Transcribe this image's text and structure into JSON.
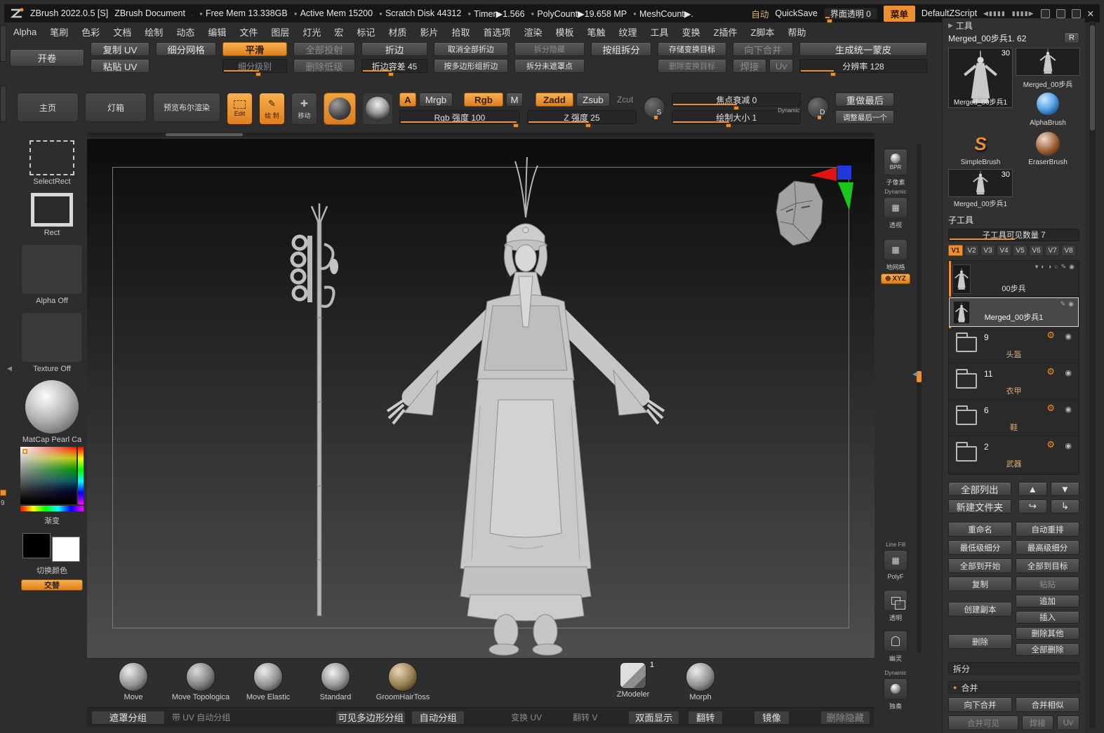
{
  "colors": {
    "accent": "#ec8f2e",
    "panel": "#313131"
  },
  "icons": {
    "close": "✕",
    "bullet": "●",
    "dot": ".",
    "tri_right": "▶",
    "collapse_left": "◀",
    "up": "▲",
    "down": "▼",
    "arrow_out": "↪",
    "arrow_in": "↳",
    "gear": "⚙",
    "eye": "◉",
    "pencil": "✎",
    "half_left": "◐",
    "half_right": "◑",
    "circle": "○",
    "caret_down": "▾",
    "plus": "✚",
    "grid": "▦",
    "win_left": "◀▮▮▮▮",
    "win_right": "▮▮▮▮▶",
    "s": "S",
    "d": "D",
    "divider_dots": "··········",
    "divider_arrows": "▲▼",
    "xyz_prefix": "⊕"
  },
  "titlebar": {
    "app_title": "ZBrush 2022.0.5 [S]",
    "doc_title": "ZBrush Document",
    "stats": [
      "Free Mem 13.338GB",
      "Active Mem 15200",
      "Scratch Disk 44312",
      "Timer▶1.566",
      "PolyCount▶19.658 MP",
      "MeshCount▶."
    ],
    "auto": "自动",
    "quicksave": "QuickSave",
    "ui_opacity": "界面透明 0",
    "menu_btn": "菜单",
    "zscript": "DefaultZScript"
  },
  "menubar": {
    "items": [
      "Alpha",
      "笔刷",
      "色彩",
      "文档",
      "绘制",
      "动态",
      "编辑",
      "文件",
      "图层",
      "灯光",
      "宏",
      "标记",
      "材质",
      "影片",
      "拾取",
      "首选项",
      "渲染",
      "模板",
      "笔触",
      "纹理",
      "工具",
      "变换",
      "Z插件",
      "Z脚本",
      "帮助"
    ]
  },
  "geo": {
    "unwrap": "开卷",
    "copy_uv": "复制 UV",
    "paste_uv": "粘贴 UV",
    "divide": "细分网格",
    "smooth": "平滑",
    "subdiv_level": "细分级别",
    "project_all": "全部投射",
    "del_lower": "删除低级",
    "crease": "折边",
    "crease_tol": "折边容差 45",
    "uncrease_all": "取消全部折边",
    "crease_pg": "按多边形组折边",
    "split_hidden": "拆分隐藏",
    "split_unmasked": "拆分未遮罩点",
    "groups_split": "按组拆分",
    "store_mt": "存储变换目标",
    "del_mt": "删除变换目标",
    "merge_down": "向下合并",
    "weld": "焊接",
    "uv": "Uv",
    "unified_skin": "生成统一蒙皮",
    "resolution": "分辨率 128"
  },
  "draw": {
    "home": "主页",
    "lightbox": "灯箱",
    "preview_boolean": "预览布尔渲染",
    "edit": "Edit",
    "draw_mode": "绘 制",
    "move_mode": "移动",
    "a": "A",
    "mrgb": "Mrgb",
    "rgb": "Rgb",
    "m": "M",
    "zadd": "Zadd",
    "zsub": "Zsub",
    "zcut": "Zcut",
    "rgb_intensity": "Rgb 强度 100",
    "z_intensity": "Z 强度 25",
    "focal_shift": "焦点衰减 0",
    "draw_size": "绘制大小 1",
    "dynamic": "Dynamic",
    "redo_last": "重做最后",
    "adjust_last": "调整最后一个"
  },
  "left_tools": {
    "select_rect": "SelectRect",
    "rect": "Rect",
    "alpha_off": "Alpha Off",
    "texture_off": "Texture Off",
    "matcap": "MatCap Pearl Ca",
    "gradient": "渐变",
    "switch_color": "切换颜色",
    "alternate": "交替"
  },
  "shelf": {
    "bpr": "BPR",
    "spix": "子像素",
    "dynamic": "Dynamic",
    "persp": "透视",
    "floor": "地网格",
    "xyz": "XYZ",
    "line_fill": "Line Fill",
    "polyf": "PolyF",
    "transp": "透明",
    "ghost": "幽灵",
    "solo": "独奏"
  },
  "tool_panel": {
    "header": "工具",
    "current": "Merged_00步兵1. 62",
    "r": "R",
    "thumb1": "Merged_00步兵1",
    "thumb1_badge": "30",
    "thumb2": "Merged_00步兵",
    "thumb3": "AlphaBrush",
    "thumb4": "SimpleBrush",
    "thumb5": "EraserBrush",
    "thumb6": "Merged_00步兵1",
    "thumb6_badge": "30"
  },
  "subtool": {
    "header": "子工具",
    "visible_count": "子工具可见数量 7",
    "tabs": [
      "V1",
      "V2",
      "V3",
      "V4",
      "V5",
      "V6",
      "V7",
      "V8"
    ],
    "first_item": "00步兵",
    "selected_item": "Merged_00步兵1",
    "folders": [
      {
        "count": "9",
        "label": "头盔"
      },
      {
        "count": "11",
        "label": "衣甲"
      },
      {
        "count": "6",
        "label": "鞋"
      },
      {
        "count": "2",
        "label": "武器"
      }
    ],
    "list_all": "全部列出",
    "new_folder": "新建文件夹",
    "rename": "重命名",
    "auto_reorder": "自动重排",
    "lowest_subdiv": "最低级细分",
    "highest_subdiv": "最高级细分",
    "all_to_start": "全部到开始",
    "all_to_target": "全部到目标",
    "copy": "复制",
    "paste": "粘贴",
    "duplicate": "创建副本",
    "append": "追加",
    "insert": "插入",
    "delete": "删除",
    "delete_other": "删除其他",
    "delete_all": "全部删除",
    "split": "拆分",
    "merge": "合并",
    "merge_down": "向下合并",
    "merge_similar": "合并相似",
    "merge_visible": "合并可见",
    "weld": "焊接",
    "uv": "Uv"
  },
  "brushes": {
    "move": "Move",
    "move_topological": "Move Topologica",
    "move_elastic": "Move Elastic",
    "standard": "Standard",
    "groom": "GroomHairToss",
    "zmodeler": "ZModeler",
    "zmodeler_badge": "1",
    "morph": "Morph"
  },
  "bottombar": {
    "mask_groups": "遮罩分组",
    "uv_auto_groups": "带 UV 自动分组",
    "visible_poly_groups": "可见多边形分组",
    "auto_groups": "自动分组",
    "transform_uv": "变换 UV",
    "flip_v": "翻转 V",
    "double_sided": "双面显示",
    "flip": "翻转",
    "mirror": "镜像",
    "delete_hidden": "删除隐藏"
  },
  "edge": {
    "nine": "9"
  }
}
